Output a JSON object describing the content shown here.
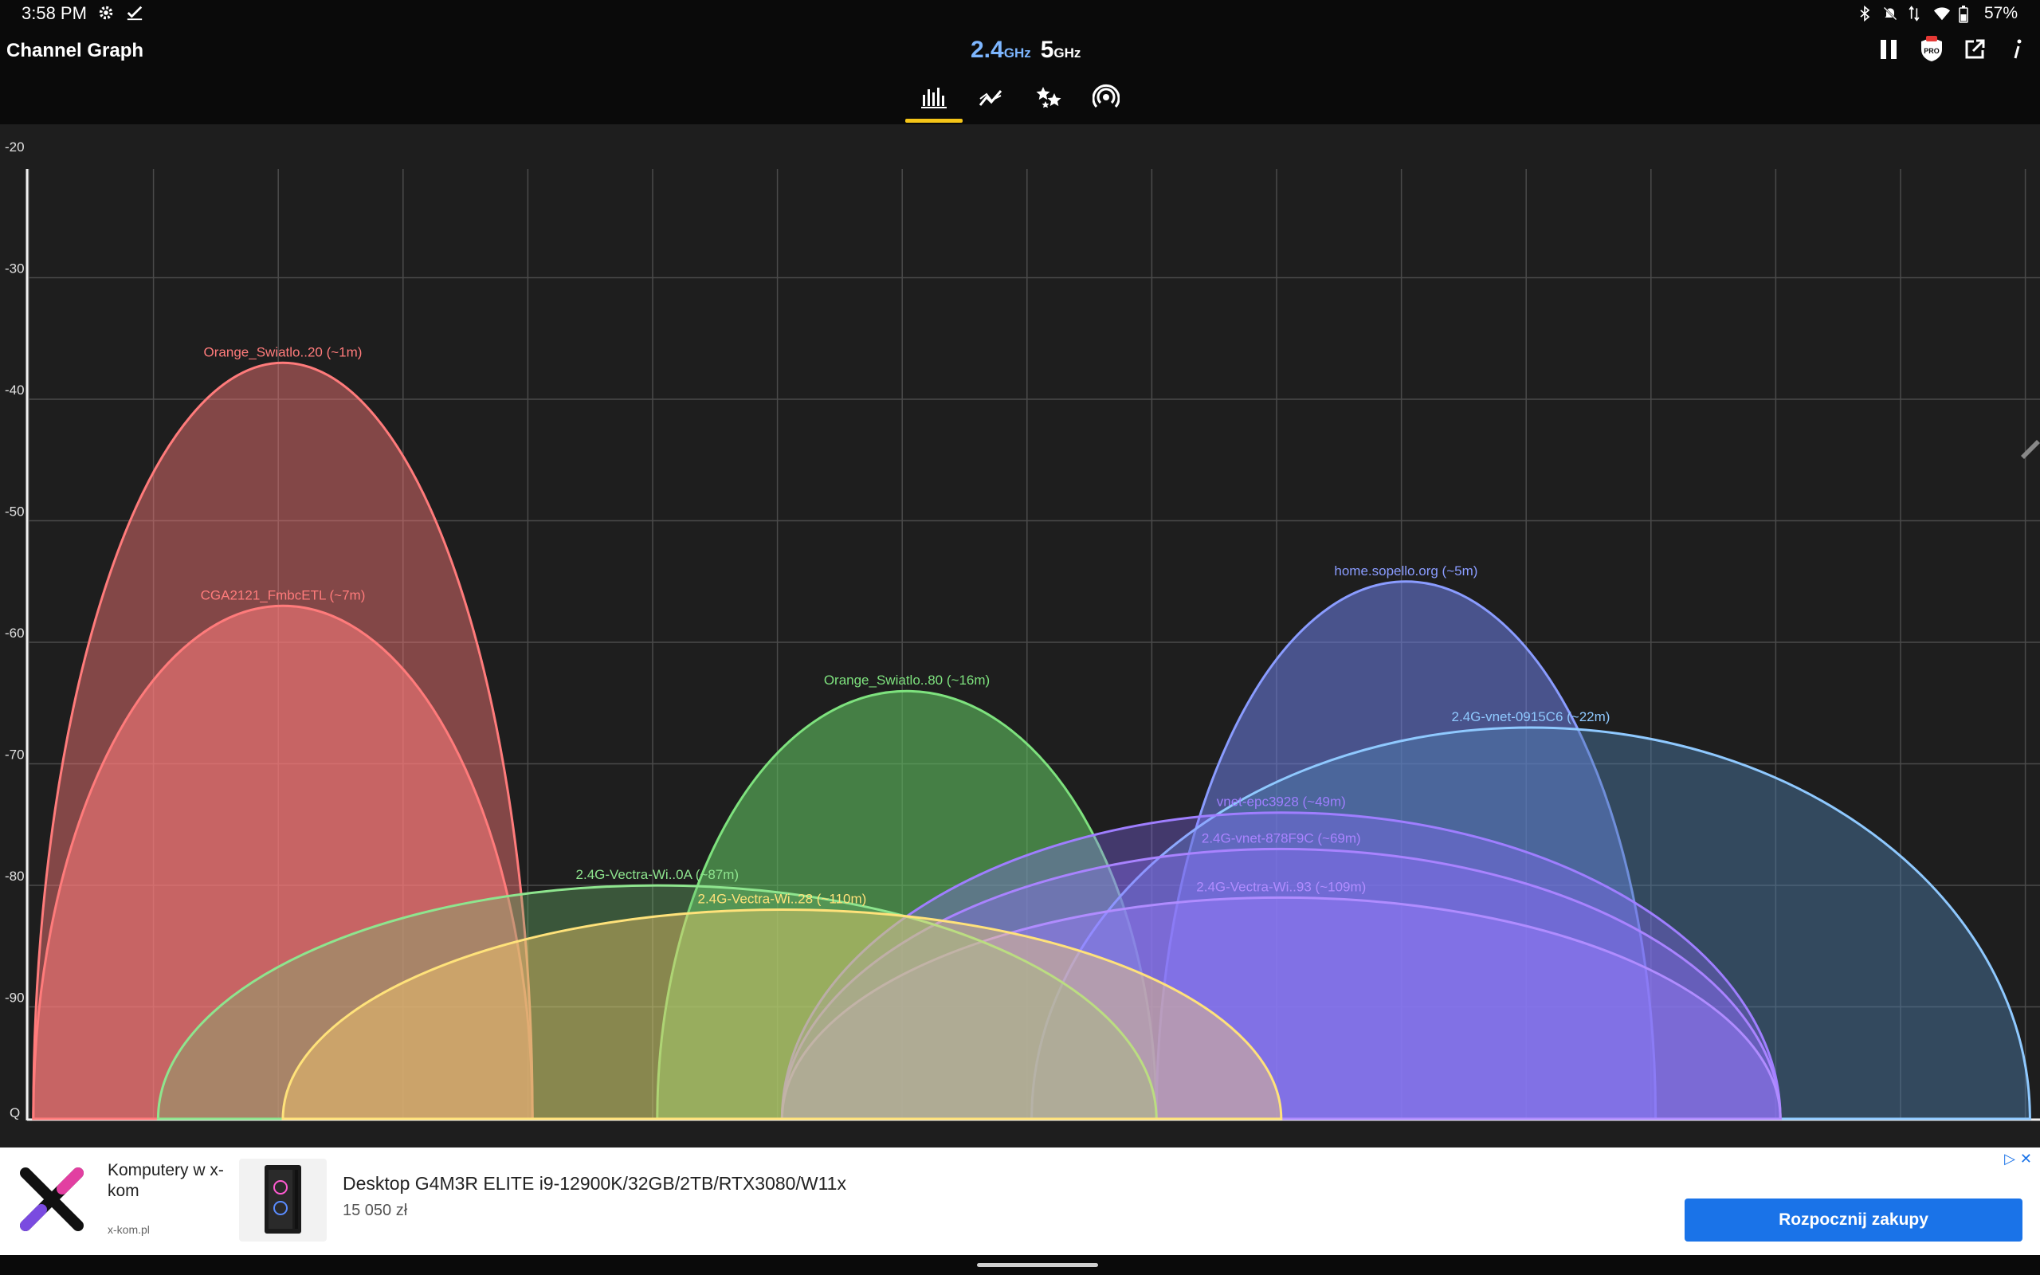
{
  "status_bar": {
    "time": "3:58 PM",
    "battery": "57%",
    "left_icons": [
      "gear-icon",
      "check-icon"
    ],
    "right_icons": [
      "bluetooth-icon",
      "mute-icon",
      "data-arrows-icon",
      "wifi-icon",
      "battery-icon"
    ]
  },
  "app": {
    "title": "Channel Graph",
    "band_24": {
      "num": "2.4",
      "unit": "GHz"
    },
    "band_5": {
      "num": "5",
      "unit": "GHz"
    },
    "tabs": [
      "bar-chart-icon",
      "trend-icon",
      "stars-icon",
      "signal-icon"
    ],
    "actions": [
      "pause-icon",
      "pro-badge-icon",
      "open-external-icon",
      "info-icon"
    ]
  },
  "chart_data": {
    "type": "area",
    "ylim": [
      -100,
      -20
    ],
    "yticks": [
      "-20",
      "-30",
      "-40",
      "-50",
      "-60",
      "-70",
      "-80",
      "-90",
      "Q"
    ],
    "grid": true,
    "networks": [
      {
        "label": "Orange_Swiatlo..20 (~1m)",
        "center": 2,
        "width": 4,
        "dbm": -37,
        "color": "#ff7b7b",
        "fill": "#ff7b7b",
        "opacity": 0.45
      },
      {
        "label": "CGA2121_FmbcETL (~7m)",
        "center": 2,
        "width": 4,
        "dbm": -57,
        "color": "#ff7b7b",
        "fill": "#ff7b7b",
        "opacity": 0.55
      },
      {
        "label": "Orange_Swiatlo..80 (~16m)",
        "center": 7,
        "width": 4,
        "dbm": -64,
        "color": "#7ee27e",
        "fill": "#5fbf5f",
        "opacity": 0.6
      },
      {
        "label": "home.sopello.org (~5m)",
        "center": 11,
        "width": 4,
        "dbm": -55,
        "color": "#8a9cff",
        "fill": "#6d7fe8",
        "opacity": 0.55
      },
      {
        "label": "2.4G-vnet-0915C6 (~22m)",
        "center": 12,
        "width": 8,
        "dbm": -67,
        "color": "#8fc9ff",
        "fill": "#4d7fae",
        "opacity": 0.45
      },
      {
        "label": "vnet-epc3928 (~49m)",
        "center": 10,
        "width": 8,
        "dbm": -74,
        "color": "#9f7eff",
        "fill": "#8a6cff",
        "opacity": 0.35
      },
      {
        "label": "2.4G-vnet-878F9C (~69m)",
        "center": 10,
        "width": 8,
        "dbm": -77,
        "color": "#a983ff",
        "fill": "#8f70ff",
        "opacity": 0.35
      },
      {
        "label": "2.4G-Vectra-Wi..93 (~109m)",
        "center": 10,
        "width": 8,
        "dbm": -81,
        "color": "#b08cff",
        "fill": "#9a7cff",
        "opacity": 0.4
      },
      {
        "label": "2.4G-Vectra-Wi..0A (~87m)",
        "center": 5,
        "width": 8,
        "dbm": -80,
        "color": "#8ee58e",
        "fill": "#70c070",
        "opacity": 0.35
      },
      {
        "label": "2.4G-Vectra-Wi..28 (~110m)",
        "center": 6,
        "width": 8,
        "dbm": -82,
        "color": "#ffe27a",
        "fill": "#ffd36e",
        "opacity": 0.4
      }
    ]
  },
  "ad": {
    "brand": "Komputery w x-kom",
    "domain": "x-kom.pl",
    "title": "Desktop G4M3R ELITE i9-12900K/32GB/2TB/RTX3080/W11x",
    "price": "15 050 zł",
    "cta": "Rozpocznij zakupy"
  }
}
